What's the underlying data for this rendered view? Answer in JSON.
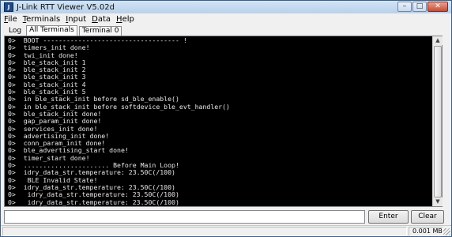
{
  "window": {
    "title": "J-Link RTT Viewer V5.02d",
    "icon_text": "J"
  },
  "controls": {
    "minimize": "–",
    "maximize": "□",
    "close": "✕"
  },
  "menu": [
    {
      "mnemonic": "F",
      "rest": "ile"
    },
    {
      "mnemonic": "T",
      "rest": "erminals"
    },
    {
      "mnemonic": "I",
      "rest": "nput"
    },
    {
      "mnemonic": "D",
      "rest": "ata"
    },
    {
      "mnemonic": "H",
      "rest": "elp"
    }
  ],
  "tabs": [
    "Log",
    "All Terminals",
    "Terminal 0"
  ],
  "terminal": {
    "lines": [
      "0>  BOOT ----------------------------------- !",
      "0>  timers_init done!",
      "0>  twi_init done!",
      "0>  ble_stack_init 1",
      "0>  ble_stack_init 2",
      "0>  ble_stack_init 3",
      "0>  ble_stack_init 4",
      "0>  ble_stack_init 5",
      "0>  in ble_stack_init before sd_ble_enable()",
      "0>  in ble_stack_init before softdevice_ble_evt_handler()",
      "0>  ble_stack_init done!",
      "0>  gap_param_init done!",
      "0>  services_init done!",
      "0>  advertising_init done!",
      "0>  conn_param_init done!",
      "0>  ble_advertising_start done!",
      "0>  timer_start done!",
      "0>  ...................... Before Main Loop!",
      "0>  idry_data_str.temperature: 23.50C(/100)",
      "0>   BLE Invalid State!",
      "0>  idry_data_str.temperature: 23.50C(/100)",
      "0>   idry_data_str.temperature: 23.50C(/100)",
      "0>   idry_data_str.temperature: 23.50C(/100)"
    ]
  },
  "input": {
    "value": ""
  },
  "buttons": {
    "enter": "Enter",
    "clear": "Clear"
  },
  "status": {
    "size": "0.001 MB"
  }
}
